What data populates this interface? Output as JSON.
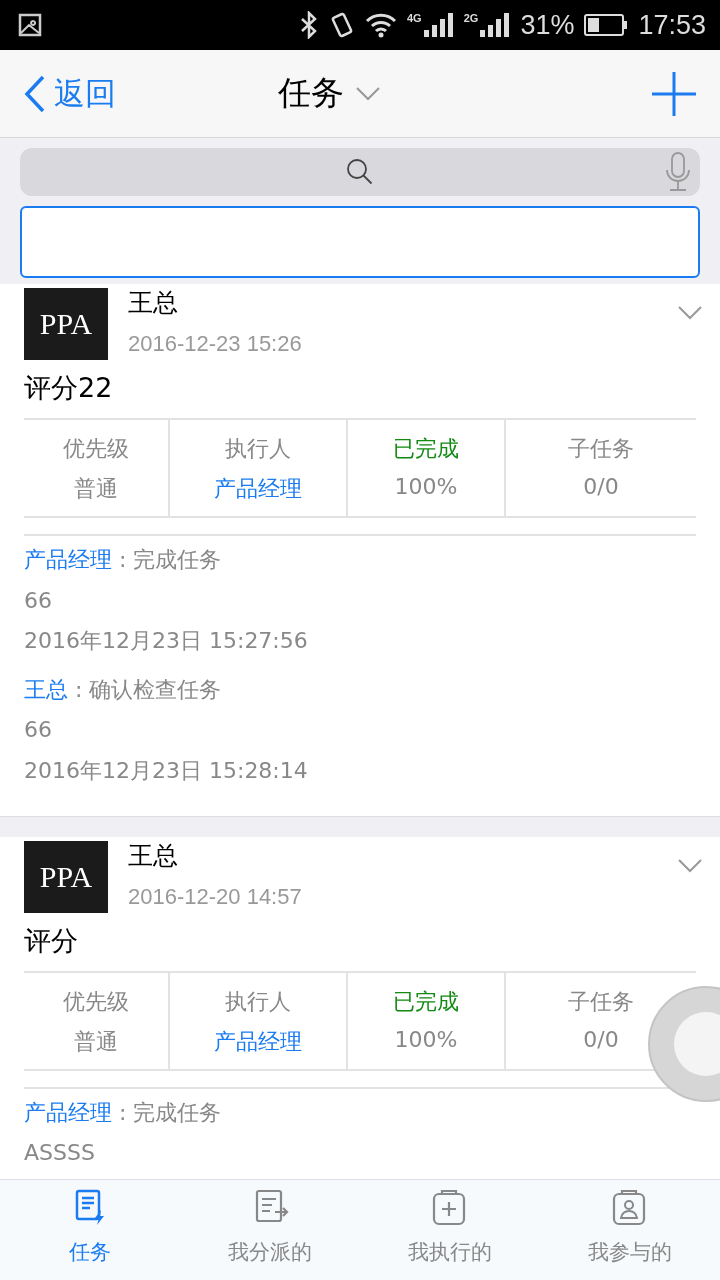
{
  "status_bar": {
    "network_labels": [
      "4G",
      "2G"
    ],
    "battery": "31%",
    "time": "17:53"
  },
  "nav": {
    "back": "返回",
    "title": "任务"
  },
  "tasks": [
    {
      "avatar_text": "PPA",
      "author": "王总",
      "time": "2016-12-23 15:26",
      "title": "评分22",
      "fields": [
        {
          "kind": "plain",
          "label": "优先级",
          "value": "普通"
        },
        {
          "kind": "person",
          "label": "执行人",
          "value": "产品经理"
        },
        {
          "kind": "status",
          "label": "已完成",
          "value": "100%"
        },
        {
          "kind": "plain",
          "label": "子任务",
          "value": "0/0"
        }
      ],
      "comments": [
        {
          "author": "产品经理",
          "separator": ":",
          "action": "完成任务",
          "body": "66",
          "time": "2016年12月23日 15:27:56"
        },
        {
          "author": "王总",
          "separator": ":",
          "action": "确认检查任务",
          "body": "66",
          "time": "2016年12月23日 15:28:14"
        }
      ]
    },
    {
      "avatar_text": "PPA",
      "author": "王总",
      "time": "2016-12-20 14:57",
      "title": "评分",
      "fields": [
        {
          "kind": "plain",
          "label": "优先级",
          "value": "普通"
        },
        {
          "kind": "person",
          "label": "执行人",
          "value": "产品经理"
        },
        {
          "kind": "status",
          "label": "已完成",
          "value": "100%"
        },
        {
          "kind": "plain",
          "label": "子任务",
          "value": "0/0"
        }
      ],
      "comments": [
        {
          "author": "产品经理",
          "separator": ":",
          "action": "完成任务",
          "body": "ASSSS"
        }
      ]
    }
  ],
  "tabs": [
    {
      "label": "任务",
      "selected": true
    },
    {
      "label": "我分派的",
      "selected": false
    },
    {
      "label": "我执行的",
      "selected": false
    },
    {
      "label": "我参与的",
      "selected": false
    }
  ]
}
